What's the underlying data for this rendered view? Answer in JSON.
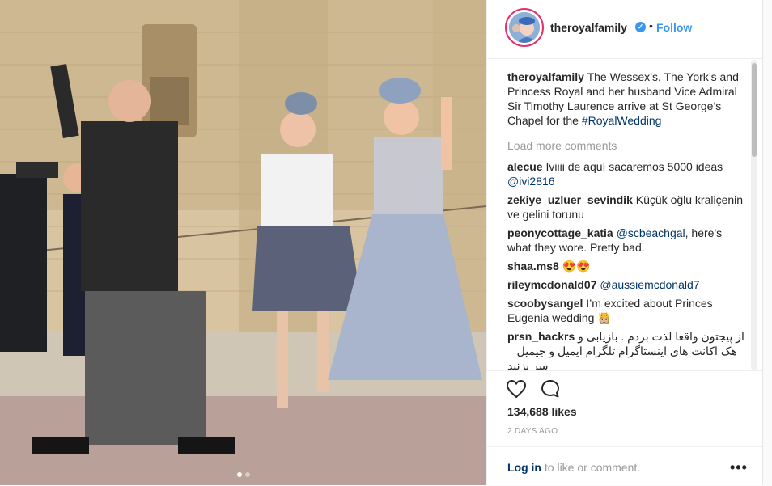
{
  "photo": {
    "alt_icon": "photo",
    "page_count": 2,
    "active_page": 1
  },
  "header": {
    "username": "theroyalfamily",
    "verified_icon": "verified-badge-icon",
    "separator": "•",
    "follow_label": "Follow"
  },
  "caption": {
    "username": "theroyalfamily",
    "text": "The Wessex’s, The York’s and Princess Royal and her husband Vice Admiral Sir Timothy Laurence arrive at St George’s Chapel for the ",
    "hashtag": "#RoyalWedding"
  },
  "load_more_label": "Load more comments",
  "comments": [
    {
      "user": "alecue",
      "text": "Iviiii de aquí sacaremos 5000 ideas ",
      "mention": "@ivi2816"
    },
    {
      "user": "zekiye_uzluer_sevindik",
      "text": "Küçük oğlu kraliçenin ve gelini torunu",
      "mention": ""
    },
    {
      "user": "peonycottage_katia",
      "text": "",
      "mention": "@scbeachgal",
      "after": ", here's what they wore. Pretty bad."
    },
    {
      "user": "shaa.ms8",
      "text": "😍😍",
      "mention": ""
    },
    {
      "user": "rileymcdonald07",
      "text": "",
      "mention": "@aussiemcdonald7"
    },
    {
      "user": "scoobysangel",
      "text": "I’m excited about Princes Eugenia wedding 👸🏼",
      "mention": ""
    },
    {
      "user": "prsn_hackrs",
      "text": "از پیجتون واقعا لذت بردم . بازیابی و هک اکانت های اینستاگرام تلگرام ایمیل و جیمیل _ سر بزنید",
      "mention": ""
    }
  ],
  "actions": {
    "like_icon": "heart-icon",
    "comment_icon": "comment-icon"
  },
  "likes": "134,688 likes",
  "timestamp": "2 DAYS AGO",
  "footer": {
    "login_link": "Log in",
    "login_rest": " to like or comment.",
    "more_label": "•••"
  }
}
